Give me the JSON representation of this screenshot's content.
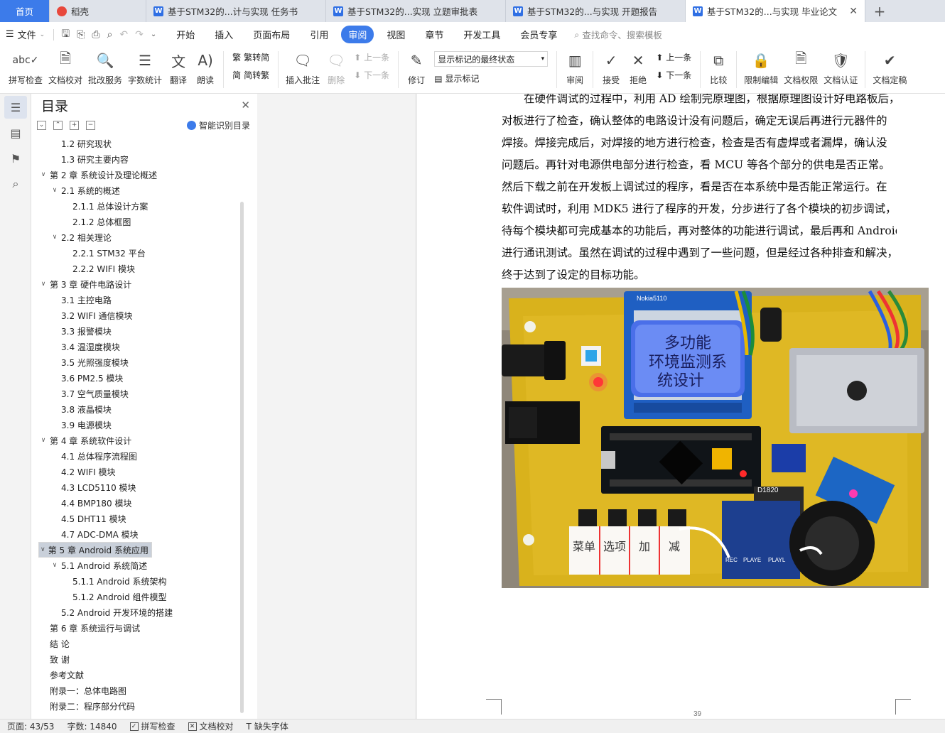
{
  "tabs": [
    {
      "label": "首页",
      "kind": "home"
    },
    {
      "label": "稻壳",
      "kind": "shell",
      "icon": "docer-icon"
    },
    {
      "label": "基于STM32的...计与实现 任务书",
      "kind": "doc",
      "icon": "word-icon"
    },
    {
      "label": "基于STM32的...实现 立题审批表",
      "kind": "doc",
      "icon": "word-icon"
    },
    {
      "label": "基于STM32的...与实现 开题报告",
      "kind": "doc",
      "icon": "word-icon"
    },
    {
      "label": "基于STM32的...与实现 毕业论文",
      "kind": "doc",
      "icon": "word-icon",
      "active": true
    }
  ],
  "menubar": {
    "file_label": "文件",
    "items": [
      "开始",
      "插入",
      "页面布局",
      "引用",
      "审阅",
      "视图",
      "章节",
      "开发工具",
      "会员专享"
    ],
    "active": "审阅",
    "search_placeholder": "查找命令、搜索模板"
  },
  "ribbon": {
    "spell_check": "拼写检查",
    "doc_proof": "文档校对",
    "proof_service": "批改服务",
    "word_count": "字数统计",
    "translate": "翻译",
    "read_aloud": "朗读",
    "to_traditional": "繁转简",
    "to_simplified": "简转繁",
    "insert_comment": "插入批注",
    "delete": "删除",
    "prev_comment": "上一条",
    "next_comment": "下一条",
    "revise": "修订",
    "markup_mode": "显示标记的最终状态",
    "show_markup": "显示标记",
    "review": "审阅",
    "accept": "接受",
    "reject": "拒绝",
    "prev_change": "上一条",
    "next_change": "下一条",
    "compare": "比较",
    "restrict_edit": "限制编辑",
    "doc_rights": "文档权限",
    "doc_cert": "文档认证",
    "doc_final": "文档定稿"
  },
  "toc": {
    "title": "目录",
    "ai_label": "智能识别目录",
    "items": [
      {
        "label": "1.2  研究现状",
        "level": 2,
        "arrow": ""
      },
      {
        "label": "1.3  研究主要内容",
        "level": 2,
        "arrow": ""
      },
      {
        "label": "第 2 章  系统设计及理论概述",
        "level": 1,
        "arrow": "v"
      },
      {
        "label": "2.1  系统的概述",
        "level": 2,
        "arrow": "v"
      },
      {
        "label": "2.1.1  总体设计方案",
        "level": 3,
        "arrow": ""
      },
      {
        "label": "2.1.2  总体框图",
        "level": 3,
        "arrow": ""
      },
      {
        "label": "2.2  相关理论",
        "level": 2,
        "arrow": "v"
      },
      {
        "label": "2.2.1 STM32 平台",
        "level": 3,
        "arrow": ""
      },
      {
        "label": "2.2.2 WIFI 模块",
        "level": 3,
        "arrow": ""
      },
      {
        "label": "第 3 章  硬件电路设计",
        "level": 1,
        "arrow": "v"
      },
      {
        "label": "3.1  主控电路",
        "level": 2,
        "arrow": ""
      },
      {
        "label": "3.2 WIFI 通信模块",
        "level": 2,
        "arrow": ""
      },
      {
        "label": "3.3  报警模块",
        "level": 2,
        "arrow": ""
      },
      {
        "label": "3.4  温湿度模块",
        "level": 2,
        "arrow": ""
      },
      {
        "label": "3.5  光照强度模块",
        "level": 2,
        "arrow": ""
      },
      {
        "label": "3.6 PM2.5 模块",
        "level": 2,
        "arrow": ""
      },
      {
        "label": "3.7  空气质量模块",
        "level": 2,
        "arrow": ""
      },
      {
        "label": "3.8  液晶模块",
        "level": 2,
        "arrow": ""
      },
      {
        "label": "3.9  电源模块",
        "level": 2,
        "arrow": ""
      },
      {
        "label": "第 4 章  系统软件设计",
        "level": 1,
        "arrow": "v"
      },
      {
        "label": "4.1  总体程序流程图",
        "level": 2,
        "arrow": ""
      },
      {
        "label": "4.2 WIFI 模块",
        "level": 2,
        "arrow": ""
      },
      {
        "label": "4.3 LCD5110 模块",
        "level": 2,
        "arrow": ""
      },
      {
        "label": "4.4 BMP180 模块",
        "level": 2,
        "arrow": ""
      },
      {
        "label": "4.5 DHT11 模块",
        "level": 2,
        "arrow": ""
      },
      {
        "label": "4.7 ADC-DMA 模块",
        "level": 2,
        "arrow": ""
      },
      {
        "label": "第 5 章  Android 系统应用",
        "level": 1,
        "arrow": "v",
        "selected": true
      },
      {
        "label": "5.1 Android 系统简述",
        "level": 2,
        "arrow": "v"
      },
      {
        "label": "5.1.1 Android 系统架构",
        "level": 3,
        "arrow": ""
      },
      {
        "label": "5.1.2 Android 组件模型",
        "level": 3,
        "arrow": ""
      },
      {
        "label": "5.2 Android 开发环境的搭建",
        "level": 2,
        "arrow": ""
      },
      {
        "label": "第 6 章  系统运行与调试",
        "level": 1,
        "arrow": ""
      },
      {
        "label": "结    论",
        "level": 1,
        "arrow": ""
      },
      {
        "label": "致    谢",
        "level": 1,
        "arrow": ""
      },
      {
        "label": "参考文献",
        "level": 1,
        "arrow": ""
      },
      {
        "label": "附录一：总体电路图",
        "level": 1,
        "arrow": ""
      },
      {
        "label": "附录二：程序部分代码",
        "level": 1,
        "arrow": ""
      }
    ]
  },
  "document": {
    "lines": [
      "在硬件调试的过程中，利用 AD 绘制完原理图，根据原理图设计好电路板后，",
      "对板进行了检查，确认整体的电路设计没有问题后，确定无误后再进行元器件的",
      "焊接。焊接完成后，对焊接的地方进行检查，检查是否有虚焊或者漏焊，确认没",
      "问题后。再针对电源供电部分进行检查，看 MCU 等各个部分的供电是否正常。",
      "然后下载之前在开发板上调试过的程序，看是否在本系统中是否能正常运行。在",
      "软件调试时，利用 MDK5 进行了程序的开发，分步进行了各个模块的初步调试，",
      "待每个模块都可完成基本的功能后，再对整体的功能进行调试，最后再和 Android",
      "进行通讯测试。虽然在调试的过程中遇到了一些问题，但是经过各种排查和解决，",
      "终于达到了设定的目标功能。"
    ],
    "photo": {
      "lcd_text_line1": "多功能",
      "lcd_text_line2": "环境监测系",
      "lcd_text_line3": "统设计",
      "lcd_header": "Nokia5110",
      "sensor_label": "D1820",
      "button_labels": [
        "菜单",
        "选项",
        "加",
        "减"
      ],
      "module_labels": [
        "PLAYE",
        "PLAYL",
        "REC"
      ],
      "board_color": "#d9b21c",
      "lcd_color": "#2b56d6"
    },
    "page_number": "39"
  },
  "status": {
    "page": "页面: 43/53",
    "words": "字数: 14840",
    "spell": "拼写检查",
    "proof": "文档校对",
    "missing_font": "缺失字体"
  },
  "colors": {
    "accent": "#3c7bea"
  }
}
